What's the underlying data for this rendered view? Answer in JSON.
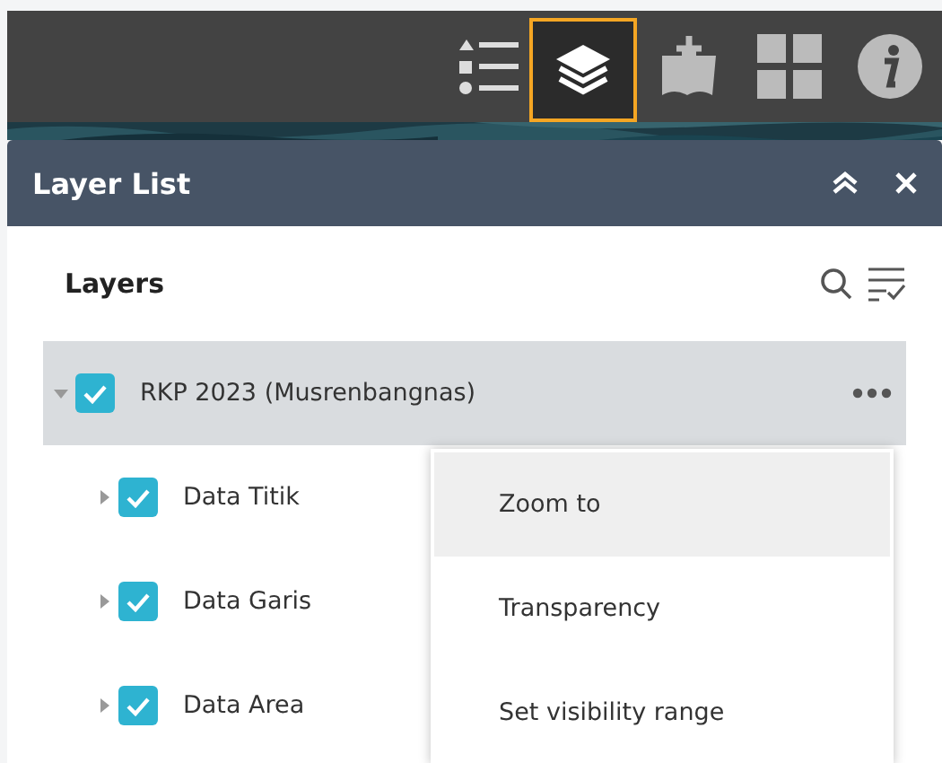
{
  "toolbar": {
    "buttons": [
      {
        "kind": "legend",
        "selected": false
      },
      {
        "kind": "layers",
        "selected": true
      },
      {
        "kind": "add-data",
        "selected": false
      },
      {
        "kind": "basemap",
        "selected": false
      },
      {
        "kind": "about",
        "selected": false
      }
    ]
  },
  "panel": {
    "title": "Layer List",
    "heading": "Layers",
    "layers": [
      {
        "label": "RKP 2023 (Musrenbangnas)",
        "checked": true,
        "expanded": true,
        "selected": true,
        "children": [
          {
            "label": "Data Titik",
            "checked": true,
            "expanded": false,
            "selected": false
          },
          {
            "label": "Data Garis",
            "checked": true,
            "expanded": false,
            "selected": false
          },
          {
            "label": "Data Area",
            "checked": true,
            "expanded": false,
            "selected": false
          }
        ]
      }
    ]
  },
  "menu": {
    "items": [
      {
        "label": "Zoom to",
        "selected": true
      },
      {
        "label": "Transparency",
        "selected": false
      },
      {
        "label": "Set visibility range",
        "selected": false
      }
    ]
  }
}
